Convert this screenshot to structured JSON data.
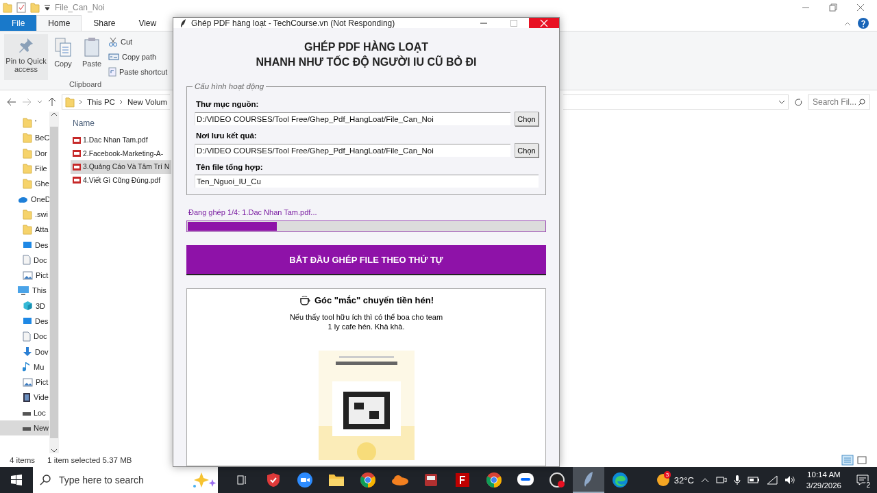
{
  "explorer": {
    "title": "File_Can_Noi",
    "tabs": [
      {
        "label": "File",
        "kind": "file",
        "selected": false
      },
      {
        "label": "Home",
        "kind": "tab",
        "selected": true
      },
      {
        "label": "Share",
        "kind": "tab",
        "selected": false
      },
      {
        "label": "View",
        "kind": "tab",
        "selected": false
      }
    ],
    "ribbon": {
      "large_buttons": [
        {
          "label": "Pin to Quick access",
          "kind": "pin"
        },
        {
          "label": "Copy",
          "kind": "copy"
        },
        {
          "label": "Paste",
          "kind": "paste"
        }
      ],
      "small_buttons": [
        {
          "label": "Cut",
          "kind": "cut"
        },
        {
          "label": "Copy path",
          "kind": "path"
        },
        {
          "label": "Paste shortcut",
          "kind": "shortcut"
        }
      ],
      "group": "Clipboard"
    },
    "breadcrumb": [
      "This PC",
      "New Volum"
    ],
    "search": {
      "placeholder": "Search Fil..."
    },
    "nav": [
      {
        "label": "'",
        "kind": "folder",
        "selected": false
      },
      {
        "label": "BeC",
        "kind": "folder",
        "selected": false
      },
      {
        "label": "Dor",
        "kind": "folder",
        "selected": false
      },
      {
        "label": "File",
        "kind": "folder",
        "selected": false
      },
      {
        "label": "Ghe",
        "kind": "folder",
        "selected": false
      },
      {
        "label": "OneD",
        "kind": "cloud",
        "selected": false,
        "children": [
          {
            "label": ".swi",
            "kind": "folder",
            "selected": false
          },
          {
            "label": "Atta",
            "kind": "folder",
            "selected": false
          },
          {
            "label": "Des",
            "kind": "desktop",
            "selected": false
          },
          {
            "label": "Doc",
            "kind": "document",
            "selected": false
          },
          {
            "label": "Pict",
            "kind": "picture",
            "selected": false
          }
        ]
      },
      {
        "label": "This",
        "kind": "pc",
        "selected": false,
        "children": [
          {
            "label": "3D",
            "kind": "cube",
            "selected": false
          },
          {
            "label": "Des",
            "kind": "desktop",
            "selected": false
          },
          {
            "label": "Doc",
            "kind": "document",
            "selected": false
          },
          {
            "label": "Dov",
            "kind": "download",
            "selected": false
          },
          {
            "label": "Mu",
            "kind": "music",
            "selected": false
          },
          {
            "label": "Pict",
            "kind": "picture",
            "selected": false
          },
          {
            "label": "Vide",
            "kind": "video",
            "selected": false
          },
          {
            "label": "Loc",
            "kind": "drive",
            "selected": false
          },
          {
            "label": "New",
            "kind": "drive",
            "selected": true
          }
        ]
      }
    ],
    "column": "Name",
    "files": [
      {
        "name": "1.Dac Nhan Tam.pdf",
        "selected": false
      },
      {
        "name": "2.Facebook-Marketing-A-",
        "selected": false
      },
      {
        "name": "3.Quảng Cáo Và Tâm Trí N",
        "selected": true
      },
      {
        "name": "4.Viết Gì Cũng Đúng.pdf",
        "selected": false
      }
    ],
    "status": {
      "count": "4 items",
      "selection": "1 item selected  5.37 MB"
    }
  },
  "dialog": {
    "title": "Ghép PDF hàng loạt - TechCourse.vn (Not Responding)",
    "heading": [
      "GHÉP PDF HÀNG LOẠT",
      "NHANH NHƯ TỐC ĐỘ NGƯỜI IU CŨ BỎ ĐI"
    ],
    "group": "Cấu hình hoạt động",
    "fields": [
      {
        "label": "Thư mục nguồn:",
        "value": "D:/VIDEO COURSES/Tool Free/Ghep_Pdf_HangLoat/File_Can_Noi",
        "button": "Chọn"
      },
      {
        "label": "Nơi lưu kết quả:",
        "value": "D:/VIDEO COURSES/Tool Free/Ghep_Pdf_HangLoat/File_Can_Noi",
        "button": "Chọn"
      },
      {
        "label": "Tên file tổng hợp:",
        "value": "Ten_Nguoi_IU_Cu"
      }
    ],
    "progress": {
      "text": "Đang ghép 1/4: 1.Dac Nhan Tam.pdf...",
      "level": 0.25
    },
    "start_button": "BẮT ĐẦU GHÉP FILE THEO THỨ TỰ",
    "donate": {
      "title": "Góc \"mắc\" chuyển tiền hén!",
      "text": "Nếu thấy tool hữu ích thì có thể boa cho team\n1 ly cafe hén. Khà khà."
    }
  },
  "taskbar": {
    "search": {
      "placeholder": "Type here to search"
    },
    "apps": [
      {
        "kind": "taskview",
        "selected": false
      },
      {
        "kind": "shield",
        "selected": false
      },
      {
        "kind": "zoom",
        "selected": false
      },
      {
        "kind": "folder",
        "selected": false
      },
      {
        "kind": "chrome",
        "selected": false
      },
      {
        "kind": "cloud",
        "selected": false
      },
      {
        "kind": "media",
        "selected": false
      },
      {
        "kind": "filezilla",
        "selected": false
      },
      {
        "kind": "chrome",
        "selected": false
      },
      {
        "kind": "zalo",
        "selected": false
      },
      {
        "kind": "obs",
        "selected": false
      },
      {
        "kind": "feather",
        "selected": true
      },
      {
        "kind": "edge",
        "selected": false
      }
    ],
    "weather": {
      "badge": "3",
      "temp": "32°C"
    },
    "time": "10:14 AM",
    "date": "3/29/2026",
    "notifications": "2"
  }
}
